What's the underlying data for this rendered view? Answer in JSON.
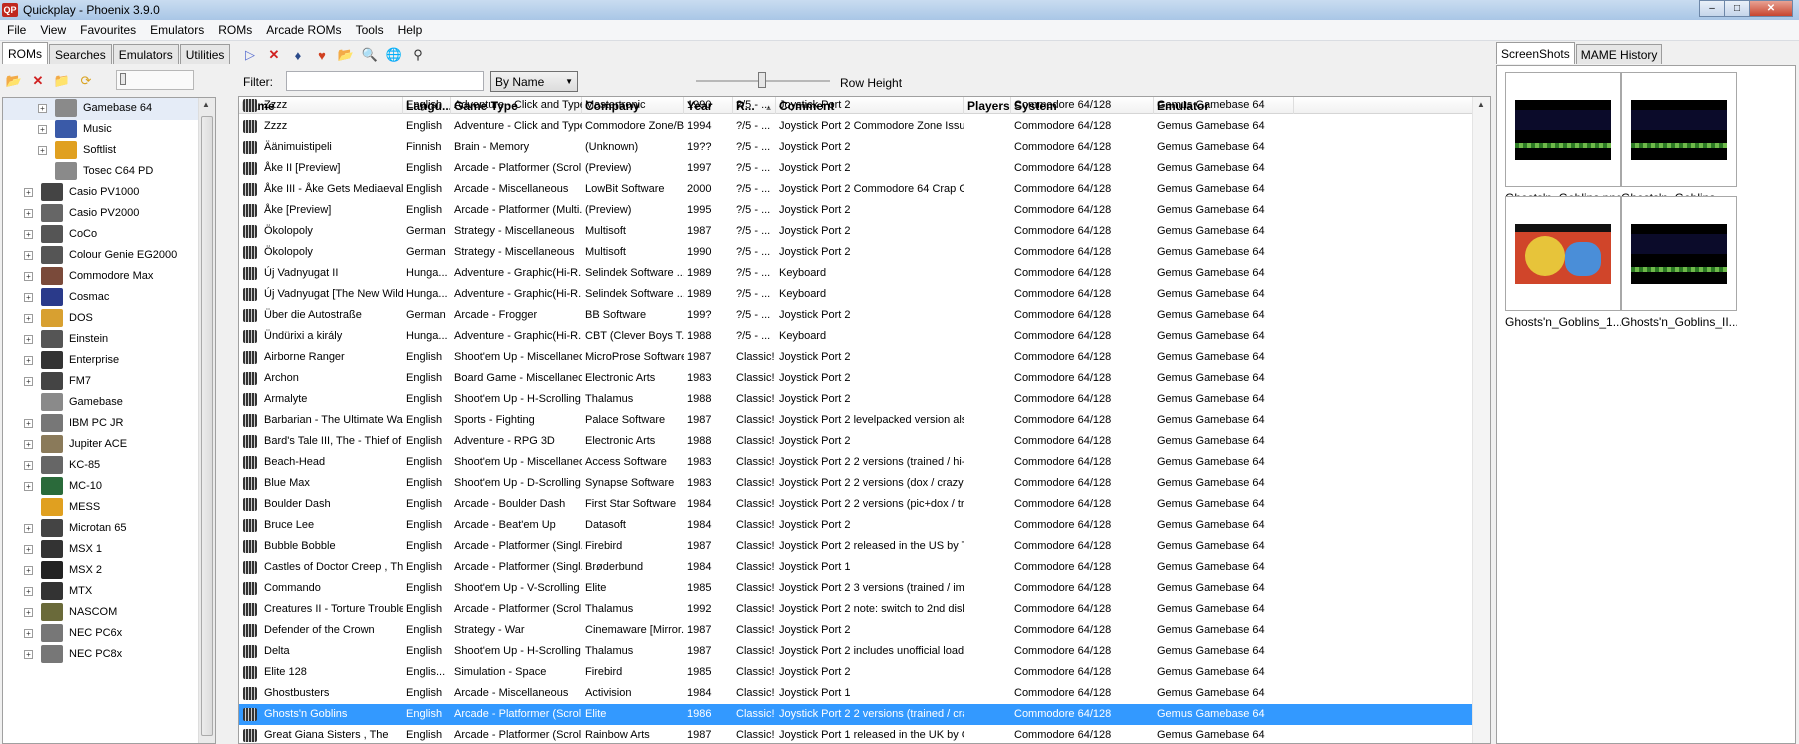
{
  "window": {
    "title": "Quickplay - Phoenix 3.9.0",
    "app_icon_text": "QP",
    "minimize": "–",
    "maximize": "□",
    "close": "✕"
  },
  "menu": [
    "File",
    "View",
    "Favourites",
    "Emulators",
    "ROMs",
    "Arcade ROMs",
    "Tools",
    "Help"
  ],
  "left_panel": {
    "tabs": [
      "ROMs",
      "Searches",
      "Emulators",
      "Utilities"
    ],
    "active_tab": "ROMs",
    "tree": [
      {
        "label": "Gamebase 64",
        "expander": "+",
        "indent": 1,
        "color": "#8a8a8a",
        "selected": true
      },
      {
        "label": "Music",
        "expander": "+",
        "indent": 1,
        "color": "#3a5aa8"
      },
      {
        "label": "Softlist",
        "expander": "+",
        "indent": 1,
        "color": "#e0a020"
      },
      {
        "label": "Tosec C64 PD",
        "expander": "",
        "indent": 1,
        "color": "#8a8a8a"
      },
      {
        "label": "Casio PV1000",
        "expander": "+",
        "indent": 0,
        "color": "#444"
      },
      {
        "label": "Casio PV2000",
        "expander": "+",
        "indent": 0,
        "color": "#666"
      },
      {
        "label": "CoCo",
        "expander": "+",
        "indent": 0,
        "color": "#555"
      },
      {
        "label": "Colour Genie EG2000",
        "expander": "+",
        "indent": 0,
        "color": "#555"
      },
      {
        "label": "Commodore Max",
        "expander": "+",
        "indent": 0,
        "color": "#7a4a3a"
      },
      {
        "label": "Cosmac",
        "expander": "+",
        "indent": 0,
        "color": "#2a3a8a"
      },
      {
        "label": "DOS",
        "expander": "+",
        "indent": 0,
        "color": "#d8a030"
      },
      {
        "label": "Einstein",
        "expander": "+",
        "indent": 0,
        "color": "#555"
      },
      {
        "label": "Enterprise",
        "expander": "+",
        "indent": 0,
        "color": "#333"
      },
      {
        "label": "FM7",
        "expander": "+",
        "indent": 0,
        "color": "#444"
      },
      {
        "label": "Gamebase",
        "expander": "",
        "indent": 0,
        "color": "#8a8a8a"
      },
      {
        "label": "IBM PC JR",
        "expander": "+",
        "indent": 0,
        "color": "#777"
      },
      {
        "label": "Jupiter ACE",
        "expander": "+",
        "indent": 0,
        "color": "#8a7a5a"
      },
      {
        "label": "KC-85",
        "expander": "+",
        "indent": 0,
        "color": "#666"
      },
      {
        "label": "MC-10",
        "expander": "+",
        "indent": 0,
        "color": "#2a6a3a"
      },
      {
        "label": "MESS",
        "expander": "",
        "indent": 0,
        "color": "#e0a020"
      },
      {
        "label": "Microtan 65",
        "expander": "+",
        "indent": 0,
        "color": "#444"
      },
      {
        "label": "MSX 1",
        "expander": "+",
        "indent": 0,
        "color": "#333"
      },
      {
        "label": "MSX 2",
        "expander": "+",
        "indent": 0,
        "color": "#222"
      },
      {
        "label": "MTX",
        "expander": "+",
        "indent": 0,
        "color": "#333"
      },
      {
        "label": "NASCOM",
        "expander": "+",
        "indent": 0,
        "color": "#6a6a3a"
      },
      {
        "label": "NEC PC6x",
        "expander": "+",
        "indent": 0,
        "color": "#777"
      },
      {
        "label": "NEC PC8x",
        "expander": "+",
        "indent": 0,
        "color": "#777"
      }
    ]
  },
  "filter": {
    "label": "Filter:",
    "value": "",
    "sort_by": "By Name",
    "row_height_label": "Row Height"
  },
  "grid": {
    "columns": [
      "Name",
      "Langu...",
      "Game Type",
      "Company",
      "Year",
      "R...",
      "Comment",
      "Players",
      "System",
      "Emulator"
    ],
    "sort_indicator": "▲",
    "rows": [
      [
        "Zzzz",
        "English",
        "Adventure - Click and Type",
        "Mastertronic",
        "1990",
        "?/5 - ...",
        "Joystick Port 2",
        "",
        "Commodore 64/128",
        "Gemus Gamebase 64"
      ],
      [
        "Zzzz",
        "English",
        "Adventure - Click and Type",
        "Commodore Zone/B...",
        "1994",
        "?/5 - ...",
        "Joystick Port 2  Commodore Zone Issue ...",
        "",
        "Commodore 64/128",
        "Gemus Gamebase 64"
      ],
      [
        "Äänimuistipeli",
        "Finnish",
        "Brain - Memory",
        "(Unknown)",
        "19??",
        "?/5 - ...",
        "Joystick Port 2",
        "",
        "Commodore 64/128",
        "Gemus Gamebase 64"
      ],
      [
        "Åke II [Preview]",
        "English",
        "Arcade - Platformer (Scrol...",
        "(Preview)",
        "1997",
        "?/5 - ...",
        "Joystick Port 2",
        "",
        "Commodore 64/128",
        "Gemus Gamebase 64"
      ],
      [
        "Åke III - Åke Gets Mediaeval",
        "English",
        "Arcade - Miscellaneous",
        "LowBit Software",
        "2000",
        "?/5 - ...",
        "Joystick Port 2  Commodore 64 Crap Ga...",
        "",
        "Commodore 64/128",
        "Gemus Gamebase 64"
      ],
      [
        "Åke [Preview]",
        "English",
        "Arcade - Platformer (Multi...",
        "(Preview)",
        "1995",
        "?/5 - ...",
        "Joystick Port 2",
        "",
        "Commodore 64/128",
        "Gemus Gamebase 64"
      ],
      [
        "Ökolopoly",
        "German",
        "Strategy - Miscellaneous",
        "Multisoft",
        "1987",
        "?/5 - ...",
        "Joystick Port 2",
        "",
        "Commodore 64/128",
        "Gemus Gamebase 64"
      ],
      [
        "Ökolopoly",
        "German",
        "Strategy - Miscellaneous",
        "Multisoft",
        "1990",
        "?/5 - ...",
        "Joystick Port 2",
        "",
        "Commodore 64/128",
        "Gemus Gamebase 64"
      ],
      [
        "Új Vadnyugat II",
        "Hunga...",
        "Adventure - Graphic(Hi-R...",
        "Selindek Software ...",
        "1989",
        "?/5 - ...",
        "Keyboard",
        "",
        "Commodore 64/128",
        "Gemus Gamebase 64"
      ],
      [
        "Új Vadnyugat [The New Wildwest]",
        "Hunga...",
        "Adventure - Graphic(Hi-R...",
        "Selindek Software ...",
        "1989",
        "?/5 - ...",
        "Keyboard",
        "",
        "Commodore 64/128",
        "Gemus Gamebase 64"
      ],
      [
        "Über die Autostraße",
        "German",
        "Arcade - Frogger",
        "BB Software",
        "199?",
        "?/5 - ...",
        "Joystick Port 2",
        "",
        "Commodore 64/128",
        "Gemus Gamebase 64"
      ],
      [
        "Ündürixi a király",
        "Hunga...",
        "Adventure - Graphic(Hi-R...",
        "CBT (Clever Boys T...",
        "1988",
        "?/5 - ...",
        "Keyboard",
        "",
        "Commodore 64/128",
        "Gemus Gamebase 64"
      ],
      [
        "Airborne Ranger",
        "English",
        "Shoot'em Up - Miscellaneous",
        "MicroProse Software",
        "1987",
        "Classic!",
        "Joystick Port 2",
        "",
        "Commodore 64/128",
        "Gemus Gamebase 64"
      ],
      [
        "Archon",
        "English",
        "Board Game - Miscellaneous",
        "Electronic Arts",
        "1983",
        "Classic!",
        "Joystick Port 2",
        "",
        "Commodore 64/128",
        "Gemus Gamebase 64"
      ],
      [
        "Armalyte",
        "English",
        "Shoot'em Up - H-Scrolling",
        "Thalamus",
        "1988",
        "Classic!",
        "Joystick Port 2",
        "",
        "Commodore 64/128",
        "Gemus Gamebase 64"
      ],
      [
        "Barbarian - The Ultimate Warrior",
        "English",
        "Sports - Fighting",
        "Palace Software",
        "1987",
        "Classic!",
        "Joystick Port 2 levelpacked version also ...",
        "",
        "Commodore 64/128",
        "Gemus Gamebase 64"
      ],
      [
        "Bard's Tale III, The - Thief of Fate",
        "English",
        "Adventure - RPG 3D",
        "Electronic Arts",
        "1988",
        "Classic!",
        "Joystick Port 2",
        "",
        "Commodore 64/128",
        "Gemus Gamebase 64"
      ],
      [
        "Beach-Head",
        "English",
        "Shoot'em Up - Miscellaneous",
        "Access Software",
        "1983",
        "Classic!",
        "Joystick Port 2 2 versions (trained / hi-s...",
        "",
        "Commodore 64/128",
        "Gemus Gamebase 64"
      ],
      [
        "Blue Max",
        "English",
        "Shoot'em Up - D-Scrolling",
        "Synapse Software",
        "1983",
        "Classic!",
        "Joystick Port 2 2 versions (dox / crazy h...",
        "",
        "Commodore 64/128",
        "Gemus Gamebase 64"
      ],
      [
        "Boulder Dash",
        "English",
        "Arcade - Boulder Dash",
        "First Star Software",
        "1984",
        "Classic!",
        "Joystick Port 2 2 versions (pic+dox / tra...",
        "",
        "Commodore 64/128",
        "Gemus Gamebase 64"
      ],
      [
        "Bruce Lee",
        "English",
        "Arcade - Beat'em Up",
        "Datasoft",
        "1984",
        "Classic!",
        "Joystick Port 2",
        "",
        "Commodore 64/128",
        "Gemus Gamebase 64"
      ],
      [
        "Bubble Bobble",
        "English",
        "Arcade - Platformer (Singl...",
        "Firebird",
        "1987",
        "Classic!",
        "Joystick Port 2  released in the US by T...",
        "",
        "Commodore 64/128",
        "Gemus Gamebase 64"
      ],
      [
        "Castles of Doctor Creep , The",
        "English",
        "Arcade - Platformer (Singl...",
        "Brøderbund",
        "1984",
        "Classic!",
        "Joystick Port 1",
        "",
        "Commodore 64/128",
        "Gemus Gamebase 64"
      ],
      [
        "Commando",
        "English",
        "Shoot'em Up - V-Scrolling",
        "Elite",
        "1985",
        "Classic!",
        "Joystick Port 2 3 versions (trained / imp...",
        "",
        "Commodore 64/128",
        "Gemus Gamebase 64"
      ],
      [
        "Creatures II - Torture Trouble",
        "English",
        "Arcade - Platformer (Scrol...",
        "Thalamus",
        "1992",
        "Classic!",
        "Joystick Port 2 note: switch to 2nd disk ...",
        "",
        "Commodore 64/128",
        "Gemus Gamebase 64"
      ],
      [
        "Defender of the Crown",
        "English",
        "Strategy - War",
        "Cinemaware [Mirror...",
        "1987",
        "Classic!",
        "Joystick Port 2",
        "",
        "Commodore 64/128",
        "Gemus Gamebase 64"
      ],
      [
        "Delta",
        "English",
        "Shoot'em Up - H-Scrolling",
        "Thalamus",
        "1987",
        "Classic!",
        "Joystick Port 2 includes unofficial loadin...",
        "",
        "Commodore 64/128",
        "Gemus Gamebase 64"
      ],
      [
        "Elite 128",
        "Englis...",
        "Simulation - Space",
        "Firebird",
        "1985",
        "Classic!",
        "Joystick Port 2",
        "",
        "Commodore 64/128",
        "Gemus Gamebase 64"
      ],
      [
        "Ghostbusters",
        "English",
        "Arcade - Miscellaneous",
        "Activision",
        "1984",
        "Classic!",
        "Joystick Port 1",
        "",
        "Commodore 64/128",
        "Gemus Gamebase 64"
      ],
      [
        "Ghosts'n Goblins",
        "English",
        "Arcade - Platformer (Scrol...",
        "Elite",
        "1986",
        "Classic!",
        "Joystick Port 2 2 versions (trained / cra...",
        "",
        "Commodore 64/128",
        "Gemus Gamebase 64"
      ],
      [
        "Great Giana Sisters , The",
        "English",
        "Arcade - Platformer (Scrol...",
        "Rainbow Arts",
        "1987",
        "Classic!",
        "Joystick Port 1  released in the UK by Go...",
        "",
        "Commodore 64/128",
        "Gemus Gamebase 64"
      ]
    ],
    "selected_index": 29
  },
  "right_panel": {
    "tabs": [
      "ScreenShots",
      "MAME History"
    ],
    "active_tab": "ScreenShots",
    "thumbnails": [
      {
        "caption": "Ghosts'n_Goblins.png",
        "kind": "game"
      },
      {
        "caption": "Ghosts'n_Goblins_-_...",
        "kind": "game"
      },
      {
        "caption": "Ghosts'n_Goblins_1....",
        "kind": "title"
      },
      {
        "caption": "Ghosts'n_Goblins_II....",
        "kind": "game"
      }
    ]
  },
  "colors": {
    "selection": "#3399ff",
    "tree_selection": "#e5ecf7"
  }
}
